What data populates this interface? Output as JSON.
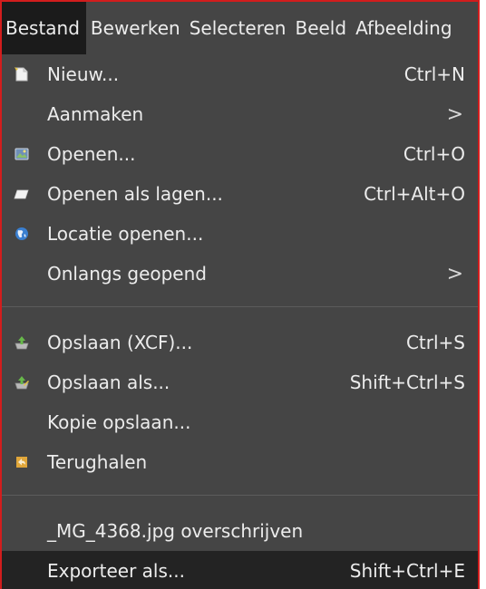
{
  "menubar": {
    "items": [
      "Bestand",
      "Bewerken",
      "Selecteren",
      "Beeld",
      "Afbeelding"
    ]
  },
  "menu": {
    "group1": [
      {
        "label": "Nieuw...",
        "shortcut": "Ctrl+N",
        "icon": "new-file-icon"
      },
      {
        "label": "Aanmaken",
        "submenu": true
      },
      {
        "label": "Openen...",
        "shortcut": "Ctrl+O",
        "icon": "open-image-icon"
      },
      {
        "label": "Openen als lagen...",
        "shortcut": "Ctrl+Alt+O",
        "icon": "open-as-layers-icon"
      },
      {
        "label": "Locatie openen...",
        "icon": "globe-icon"
      },
      {
        "label": "Onlangs geopend",
        "submenu": true
      }
    ],
    "group2": [
      {
        "label": "Opslaan (XCF)...",
        "shortcut": "Ctrl+S",
        "icon": "save-icon"
      },
      {
        "label": "Opslaan als...",
        "shortcut": "Shift+Ctrl+S",
        "icon": "save-as-icon"
      },
      {
        "label": "Kopie opslaan..."
      },
      {
        "label": "Terughalen",
        "icon": "revert-icon"
      }
    ],
    "group3": [
      {
        "label": "_MG_4368.jpg overschrijven"
      },
      {
        "label": "Exporteer als...",
        "shortcut": "Shift+Ctrl+E",
        "highlighted": true
      }
    ],
    "submenu_arrow": ">"
  },
  "colors": {
    "menu_bg": "#454545",
    "highlight_bg": "#232323",
    "text": "#ececec",
    "frame_border": "#d21d1d"
  }
}
